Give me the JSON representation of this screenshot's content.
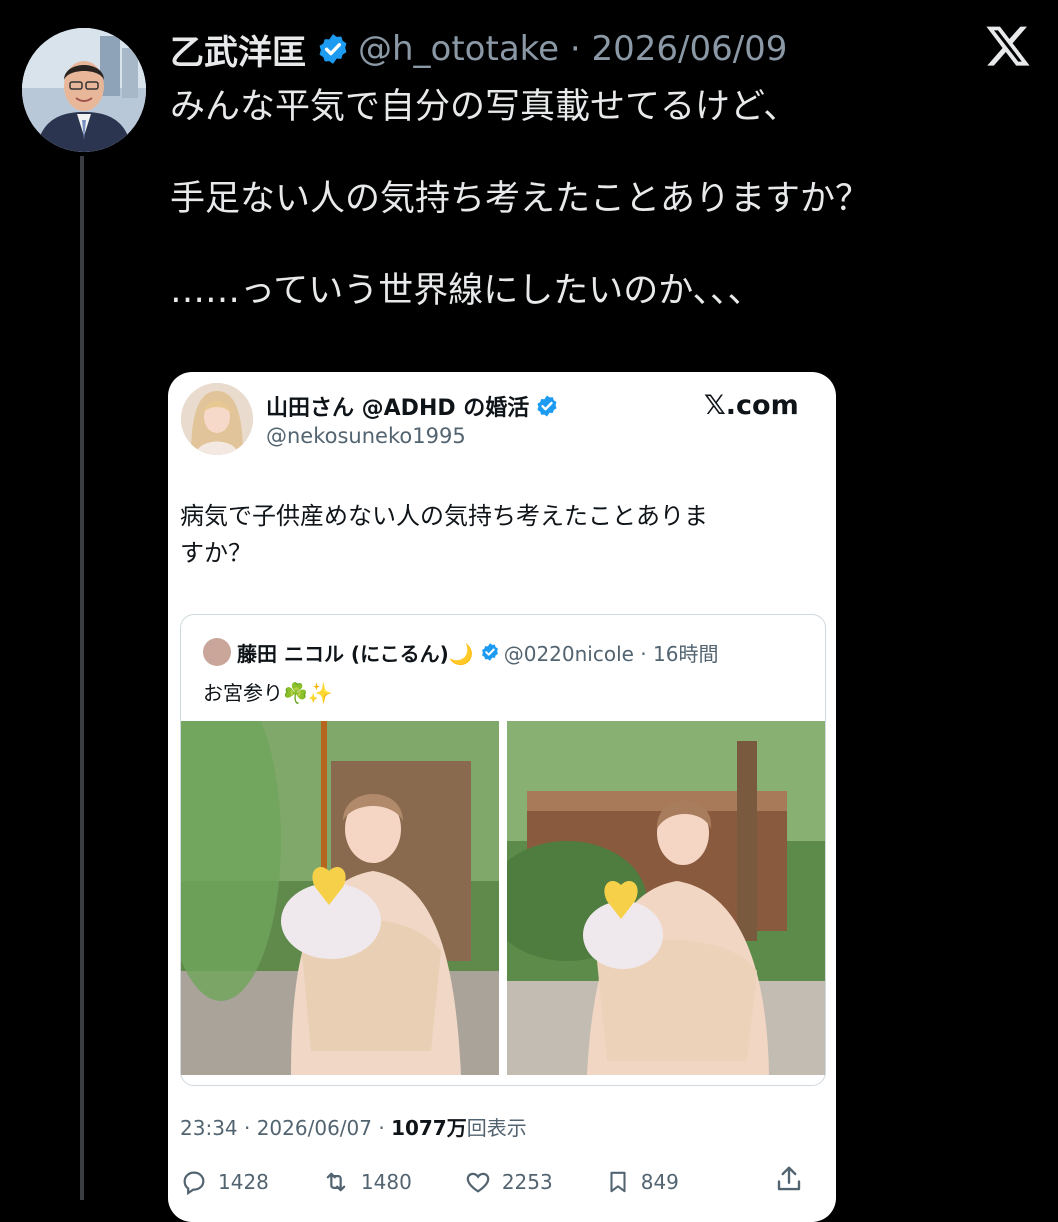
{
  "post": {
    "author_name": "乙武洋匡",
    "handle_and_date": "@h_ototake · 2026/06/09",
    "text": [
      "みんな平気で自分の写真載せてるけど、",
      "手足ない人の気持ち考えたことありますか？",
      "……っていう世界線にしたいのか、、、"
    ],
    "icons": {
      "verified": "verified-badge-icon",
      "logo": "x-logo-icon"
    },
    "colors": {
      "background": "#000000",
      "text": "#e7e9ea",
      "muted": "#8b98a5",
      "verified": "#1d9bf0"
    }
  },
  "embedded": {
    "author_name": "山田さん @ADHD の婚活",
    "handle": "@nekosuneko1995",
    "site": "𝕏.com",
    "text": [
      "病気で子供産めない人の気持ち考えたことありま",
      "すか？"
    ],
    "quoted": {
      "author_name": "藤田 ニコル (にこるん)🌙",
      "handle_time": "@0220nicole · 16時間",
      "text": "お宮参り☘️✨"
    },
    "meta": {
      "time": "23:34 · 2026/06/07 · ",
      "views_count": "1077万",
      "views_label": "回表示"
    },
    "stats": {
      "replies": "1428",
      "reposts": "1480",
      "likes": "2253",
      "bookmarks": "849"
    }
  }
}
